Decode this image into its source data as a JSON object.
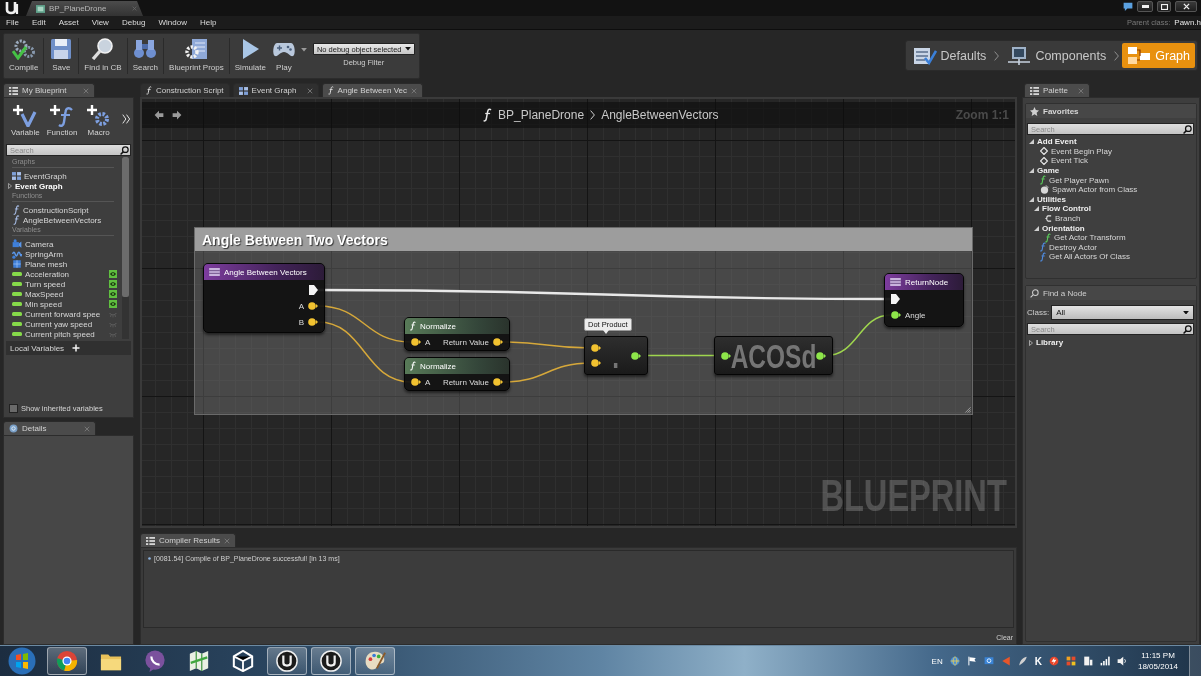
{
  "title_bar": {
    "document_tab": "BP_PlaneDrone"
  },
  "menu_bar": {
    "items": [
      "File",
      "Edit",
      "Asset",
      "View",
      "Debug",
      "Window",
      "Help"
    ],
    "parent_class_label": "Parent class:",
    "parent_class": "Pawn.h"
  },
  "toolbar": {
    "buttons": [
      {
        "kind": "compile",
        "label": "Compile"
      },
      {
        "kind": "save",
        "label": "Save"
      },
      {
        "kind": "find",
        "label": "Find in CB"
      },
      {
        "kind": "search",
        "label": "Search"
      },
      {
        "kind": "props",
        "label": "Blueprint Props"
      },
      {
        "kind": "simulate",
        "label": "Simulate"
      },
      {
        "kind": "play",
        "label": "Play"
      }
    ],
    "debug_filter": {
      "value": "No debug object selected",
      "label": "Debug Filter"
    }
  },
  "modes": [
    {
      "kind": "defaults",
      "label": "Defaults",
      "selected": false
    },
    {
      "kind": "components",
      "label": "Components",
      "selected": false
    },
    {
      "kind": "graph",
      "label": "Graph",
      "selected": true
    }
  ],
  "my_blueprint": {
    "tab": "My Blueprint",
    "add_buttons": [
      {
        "kind": "variable",
        "label": "Variable"
      },
      {
        "kind": "function",
        "label": "Function"
      },
      {
        "kind": "macro",
        "label": "Macro"
      }
    ],
    "search": {
      "placeholder": "Search"
    },
    "graphs": {
      "title": "Graphs",
      "items": [
        {
          "label": "EventGraph"
        }
      ],
      "group": {
        "label": "Event Graph",
        "expanded": false
      }
    },
    "functions": {
      "title": "Functions",
      "items": [
        {
          "label": "ConstructionScript"
        },
        {
          "label": "AngleBetweenVectors"
        }
      ]
    },
    "variables": {
      "title": "Variables",
      "components": [
        {
          "kind": "camera",
          "label": "Camera"
        },
        {
          "kind": "spring_arm",
          "label": "SpringArm"
        },
        {
          "kind": "mesh",
          "label": "Plane mesh"
        }
      ],
      "values": [
        {
          "label": "Acceleration",
          "exposed": true
        },
        {
          "label": "Turn speed",
          "exposed": true
        },
        {
          "label": "MaxSpeed",
          "exposed": true
        },
        {
          "label": "Min speed",
          "exposed": true
        },
        {
          "label": "Current forward spee",
          "exposed": false
        },
        {
          "label": "Current yaw speed",
          "exposed": false
        },
        {
          "label": "Current pitch speed",
          "exposed": false
        }
      ]
    },
    "local_variables": "Local Variables",
    "show_inherited": {
      "label": "Show inherited variables",
      "checked": false
    }
  },
  "details": {
    "tab": "Details"
  },
  "graph_editor": {
    "tabs": [
      {
        "kind": "function",
        "label": "Construction Script",
        "closable": false,
        "selected": false
      },
      {
        "kind": "event_graph",
        "label": "Event Graph",
        "closable": true,
        "selected": false
      },
      {
        "kind": "function",
        "label": "Angle Between Vec",
        "closable": true,
        "selected": true
      }
    ],
    "breadcrumb": {
      "blueprint": "BP_PlaneDrone",
      "graph": "AngleBetweenVectors"
    },
    "zoom": "Zoom 1:1",
    "comment": "Angle Between Two Vectors",
    "nodes": [
      {
        "kind": "entry",
        "title": "Angle Between Vectors",
        "outputs": [
          {
            "kind": "exec"
          },
          {
            "kind": "vector",
            "label": "A"
          },
          {
            "kind": "vector",
            "label": "B"
          }
        ]
      },
      {
        "kind": "function",
        "title": "Normalize",
        "inputs": [
          {
            "kind": "vector",
            "label": "A"
          }
        ],
        "outputs": [
          {
            "kind": "vector",
            "label": "Return Value"
          }
        ]
      },
      {
        "kind": "function",
        "title": "Normalize",
        "inputs": [
          {
            "kind": "vector",
            "label": "A"
          }
        ],
        "outputs": [
          {
            "kind": "vector",
            "label": "Return Value"
          }
        ]
      },
      {
        "kind": "compact",
        "tooltip": "Dot Product",
        "symbol": ".",
        "inputs": [
          {
            "kind": "vector"
          },
          {
            "kind": "vector"
          }
        ],
        "outputs": [
          {
            "kind": "float"
          }
        ]
      },
      {
        "kind": "compact",
        "symbol": "ACOSd",
        "inputs": [
          {
            "kind": "float"
          }
        ],
        "outputs": [
          {
            "kind": "float"
          }
        ]
      },
      {
        "kind": "result",
        "title": "ReturnNode",
        "inputs": [
          {
            "kind": "exec"
          },
          {
            "kind": "float",
            "label": "Angle"
          }
        ]
      }
    ],
    "corner_label": "BLUEPRINT"
  },
  "compiler_results": {
    "tab": "Compiler Results",
    "messages": [
      "[0081.54] Compile of BP_PlaneDrone successful! [in 13 ms]"
    ],
    "clear": "Clear"
  },
  "palette": {
    "tab": "Palette",
    "favorites": {
      "title": "Favorites",
      "search": {
        "placeholder": "Search"
      },
      "tree": [
        {
          "kind": "category",
          "label": "Add Event",
          "expanded": true,
          "children": [
            {
              "kind": "event",
              "label": "Event Begin Play"
            },
            {
              "kind": "event",
              "label": "Event Tick"
            }
          ]
        },
        {
          "kind": "category",
          "label": "Game",
          "expanded": true,
          "children": [
            {
              "kind": "pure_function",
              "label": "Get Player Pawn"
            },
            {
              "kind": "spawn",
              "label": "Spawn Actor from Class"
            }
          ]
        },
        {
          "kind": "category",
          "label": "Utilities",
          "expanded": true,
          "children": [
            {
              "kind": "category",
              "label": "Flow Control",
              "expanded": true,
              "children": [
                {
                  "kind": "branch",
                  "label": "Branch"
                }
              ]
            },
            {
              "kind": "category",
              "label": "Orientation",
              "expanded": true,
              "children": [
                {
                  "kind": "pure_function",
                  "label": "Get Actor Transform"
                }
              ]
            },
            {
              "kind": "function",
              "label": "Destroy Actor"
            },
            {
              "kind": "function",
              "label": "Get All Actors Of Class"
            }
          ]
        }
      ]
    },
    "find_node": {
      "title": "Find a Node",
      "class_label": "Class:",
      "class_value": "All",
      "search": {
        "placeholder": "Search"
      },
      "tree": [
        {
          "kind": "category",
          "label": "Library",
          "expanded": false
        }
      ]
    }
  },
  "taskbar": {
    "apps": [
      {
        "kind": "browser",
        "running": true
      },
      {
        "kind": "files",
        "running": false
      },
      {
        "kind": "messenger",
        "running": false
      },
      {
        "kind": "maps",
        "running": false
      },
      {
        "kind": "cube",
        "running": false
      },
      {
        "kind": "engine",
        "running": true
      },
      {
        "kind": "engine",
        "running": true
      },
      {
        "kind": "paint",
        "running": true
      }
    ],
    "language": "EN",
    "tray_letter": "K",
    "time": "11:15 PM",
    "date": "18/05/2014"
  }
}
